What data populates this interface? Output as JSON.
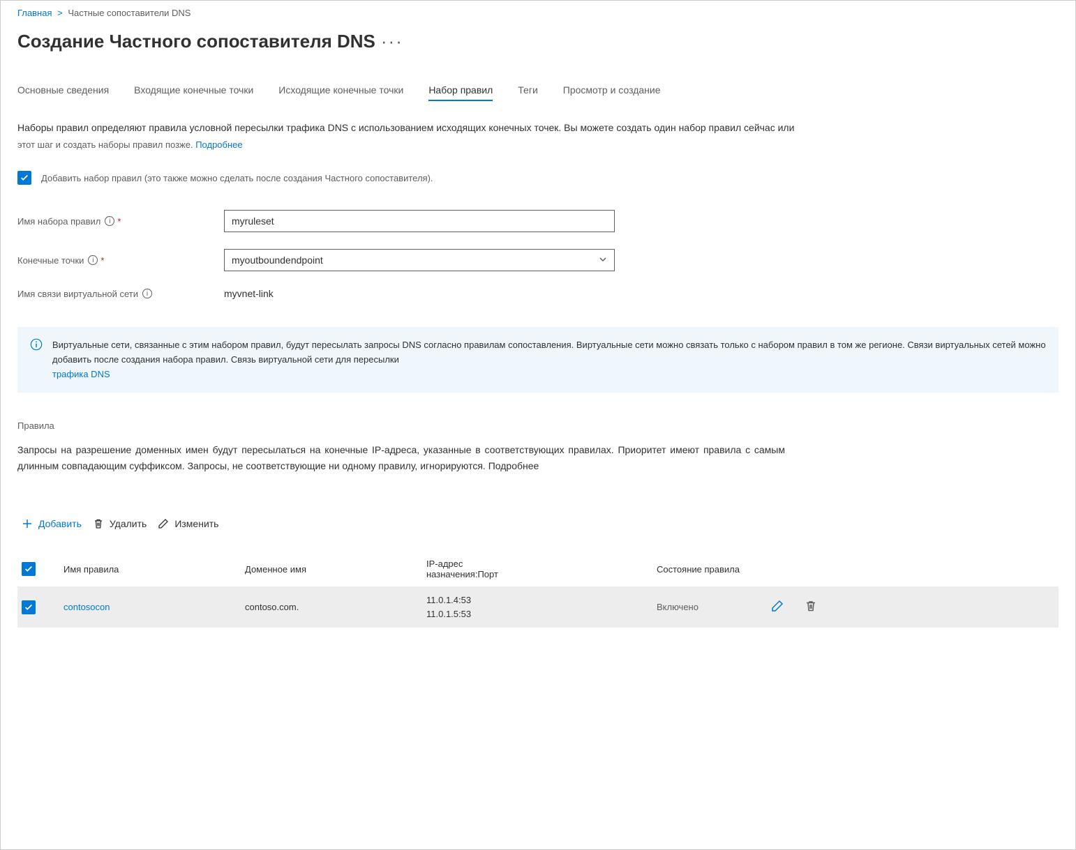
{
  "breadcrumb": {
    "home": "Главная",
    "current": "Частные сопоставители DNS"
  },
  "page_title": "Создание Частного сопоставителя DNS",
  "tabs": [
    {
      "label": "Основные сведения",
      "active": false
    },
    {
      "label": "Входящие конечные точки",
      "active": false
    },
    {
      "label": "Исходящие конечные точки",
      "active": false
    },
    {
      "label": "Набор правил",
      "active": true
    },
    {
      "label": "Теги",
      "active": false
    },
    {
      "label": "Просмотр и создание",
      "active": false
    }
  ],
  "ruleset_description": "Наборы правил определяют правила условной пересылки трафика DNS с использованием исходящих конечных точек. Вы можете создать один набор правил сейчас или",
  "ruleset_sub": "этот шаг и создать наборы правил позже. ",
  "ruleset_learn_more": "Подробнее",
  "add_ruleset_checkbox": "Добавить набор правил (это также можно сделать после создания Частного сопоставителя).",
  "form": {
    "ruleset_name_label": "Имя набора правил",
    "ruleset_name_value": "myruleset",
    "endpoints_label": "Конечные точки",
    "endpoint_selected": "myoutboundendpoint",
    "vnet_link_label": "Имя связи виртуальной сети",
    "vnet_link_value": "myvnet-link"
  },
  "info_banner": {
    "text": "Виртуальные сети, связанные с этим набором правил, будут пересылать запросы DNS согласно правилам сопоставления. Виртуальные сети можно связать только с набором правил в том же регионе. Связи виртуальных сетей можно добавить после создания набора правил. Связь виртуальной сети для пересылки",
    "link": "трафика DNS"
  },
  "rules_section_label": "Правила",
  "rules_description": "Запросы на разрешение доменных имен будут пересылаться на конечные IP-адреса, указанные в соответствующих правилах. Приоритет имеют правила с самым длинным совпадающим суффиксом. Запросы, не соответствующие ни одному правилу, игнорируются. Подробнее",
  "toolbar": {
    "add": "Добавить",
    "delete": "Удалить",
    "edit": "Изменить"
  },
  "table": {
    "headers": {
      "rule_name": "Имя правила",
      "domain": "Доменное имя",
      "ip": "IP-адрес назначения:Порт",
      "state": "Состояние правила"
    },
    "row": {
      "name": "contosocon",
      "domain": "contoso.com.",
      "ip1": "11.0.1.4:53",
      "ip2": "11.0.1.5:53",
      "state": "Включено"
    }
  }
}
